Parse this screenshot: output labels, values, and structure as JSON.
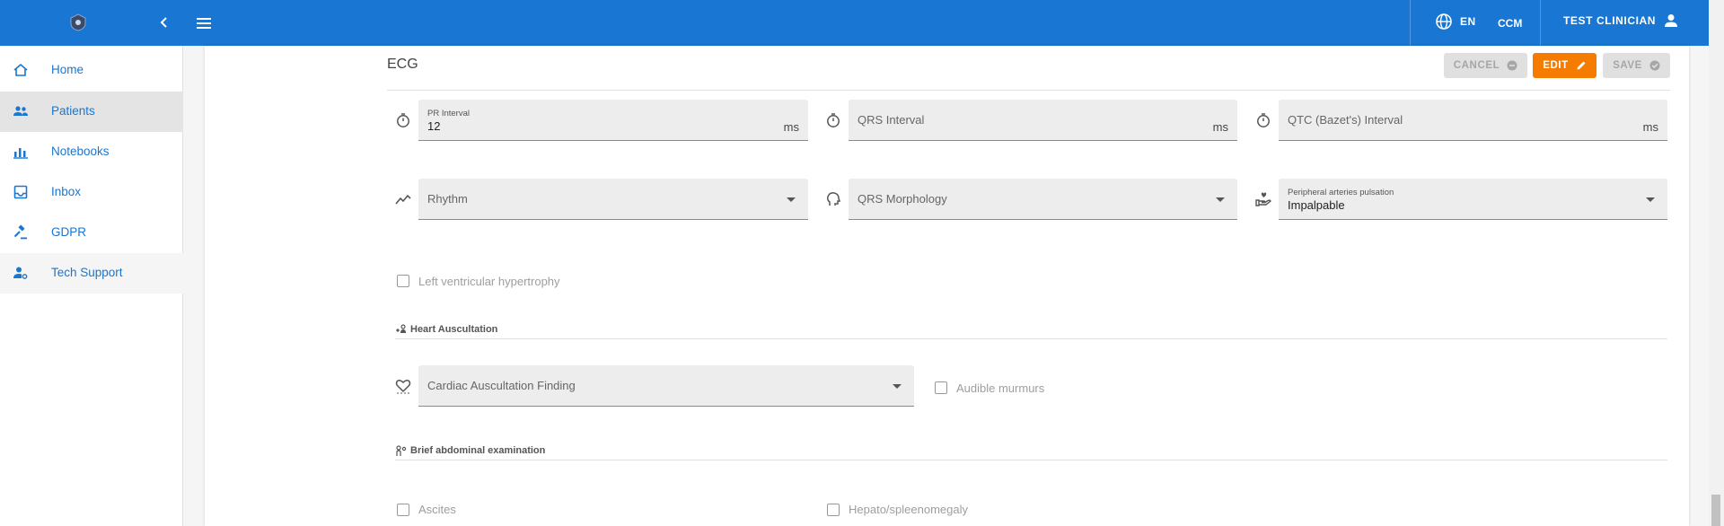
{
  "topbar": {
    "language": "EN",
    "org": "CCM",
    "user": "TEST CLINICIAN",
    "colors": {
      "primary": "#1976d2"
    }
  },
  "sidebar": {
    "items": [
      {
        "label": "Home",
        "icon": "home-icon"
      },
      {
        "label": "Patients",
        "icon": "people-icon",
        "active": true
      },
      {
        "label": "Notebooks",
        "icon": "bar-chart-icon"
      },
      {
        "label": "Inbox",
        "icon": "inbox-icon"
      },
      {
        "label": "GDPR",
        "icon": "gavel-icon"
      },
      {
        "label": "Tech Support",
        "icon": "manage-accounts-icon"
      }
    ]
  },
  "ecg": {
    "title": "ECG",
    "buttons": {
      "cancel": "CANCEL",
      "edit": "EDIT",
      "save": "SAVE"
    },
    "pr_interval": {
      "label": "PR Interval",
      "value": "12",
      "unit": "ms"
    },
    "qrs_interval": {
      "placeholder": "QRS Interval",
      "unit": "ms"
    },
    "qtc_interval": {
      "placeholder": "QTC (Bazet's) Interval",
      "unit": "ms"
    },
    "rhythm": {
      "placeholder": "Rhythm"
    },
    "qrs_morphology": {
      "placeholder": "QRS Morphology"
    },
    "peripheral": {
      "label": "Peripheral arteries pulsation",
      "value": "Impalpable"
    },
    "lvh_label": "Left ventricular hypertrophy"
  },
  "heart": {
    "title": "Heart Auscultation",
    "finding_placeholder": "Cardiac Auscultation Finding",
    "murmurs_label": "Audible murmurs"
  },
  "abdominal": {
    "title": "Brief abdominal examination",
    "ascites_label": "Ascites",
    "hepato_label": "Hepato/spleenomegaly"
  },
  "colors": {
    "accent_orange": "#f57c00"
  }
}
